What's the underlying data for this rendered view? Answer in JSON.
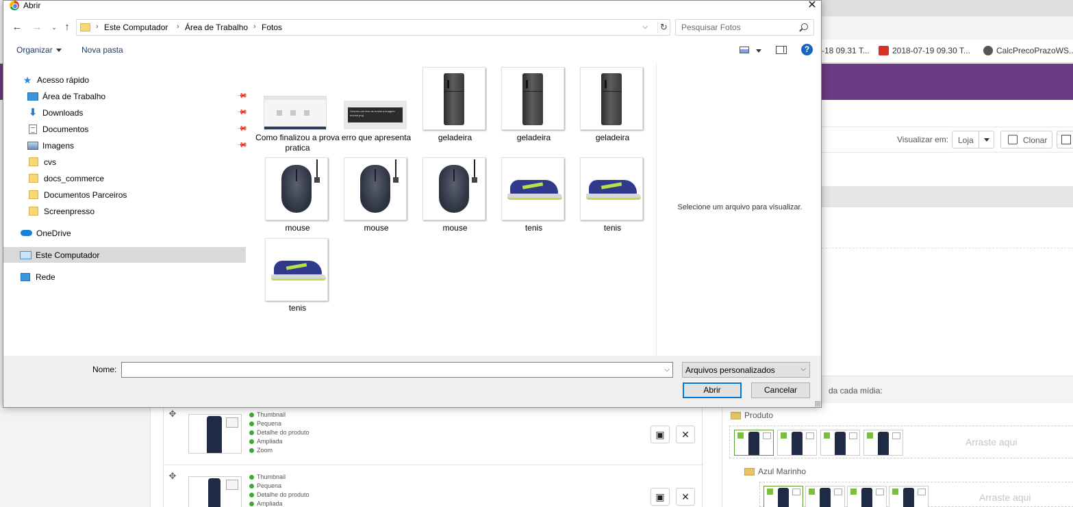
{
  "background": {
    "bookmarks": [
      {
        "label": "-18 09.31 T..."
      },
      {
        "label": "2018-07-19 09.30 T..."
      },
      {
        "label": "CalcPrecoPrazoWS..."
      }
    ],
    "toolbar": {
      "view_label": "Visualizar em:",
      "view_value": "Loja",
      "clone_label": "Clonar"
    },
    "media_section_label": "da cada mídia:",
    "media_rows": [
      {
        "sizes": [
          "Thumbnail",
          "Pequena",
          "Detalhe do produto",
          "Ampliada",
          "Zoom"
        ]
      },
      {
        "sizes": [
          "Thumbnail",
          "Pequena",
          "Detalhe do produto",
          "Ampliada"
        ]
      }
    ],
    "tree": {
      "folder_product": "Produto",
      "folder_variant": "Azul Marinho",
      "drop_text": "Arraste aqui"
    }
  },
  "dialog": {
    "title": "Abrir",
    "breadcrumbs": [
      "Este Computador",
      "Área de Trabalho",
      "Fotos"
    ],
    "search_placeholder": "Pesquisar Fotos",
    "commands": {
      "organize": "Organizar",
      "new_folder": "Nova pasta"
    },
    "nav": {
      "quick_access": "Acesso rápido",
      "items": [
        {
          "label": "Área de Trabalho"
        },
        {
          "label": "Downloads"
        },
        {
          "label": "Documentos"
        },
        {
          "label": "Imagens"
        },
        {
          "label": "cvs"
        },
        {
          "label": "docs_commerce"
        },
        {
          "label": "Documentos Parceiros"
        },
        {
          "label": "Screenpresso"
        }
      ],
      "onedrive": "OneDrive",
      "this_pc": "Este Computador",
      "network": "Rede"
    },
    "files": [
      {
        "label": "Como finalizou a prova pratica",
        "kind": "screenshot"
      },
      {
        "label": "erro que apresenta",
        "kind": "error-screenshot"
      },
      {
        "label": "geladeira",
        "kind": "fridge"
      },
      {
        "label": "geladeira",
        "kind": "fridge"
      },
      {
        "label": "geladeira",
        "kind": "fridge"
      },
      {
        "label": "mouse",
        "kind": "mouse"
      },
      {
        "label": "mouse",
        "kind": "mouse"
      },
      {
        "label": "mouse",
        "kind": "mouse"
      },
      {
        "label": "tenis",
        "kind": "shoe"
      },
      {
        "label": "tenis",
        "kind": "shoe"
      },
      {
        "label": "tenis",
        "kind": "shoe"
      }
    ],
    "preview_text": "Selecione um arquivo para visualizar.",
    "footer": {
      "name_label": "Nome:",
      "name_value": "",
      "filter_value": "Arquivos personalizados",
      "open_label": "Abrir",
      "cancel_label": "Cancelar"
    }
  }
}
